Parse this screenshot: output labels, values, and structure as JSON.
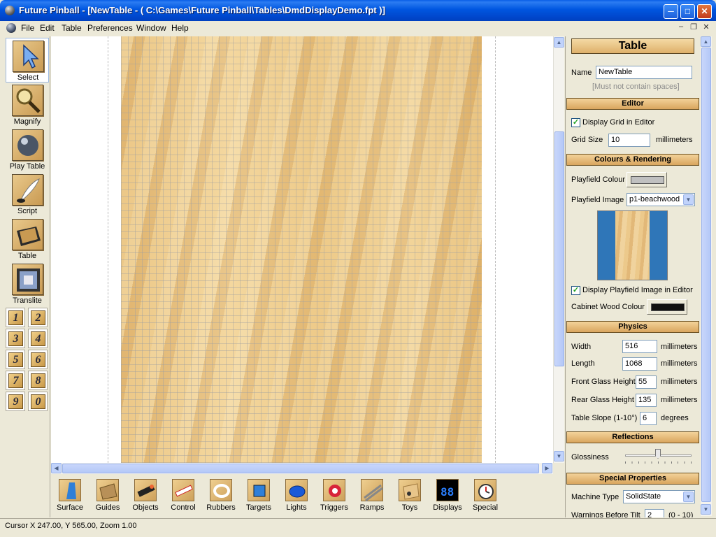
{
  "window": {
    "title": "Future Pinball - [NewTable - ( C:\\Games\\Future Pinball\\Tables\\DmdDisplayDemo.fpt )]",
    "minimize_glyph": "─",
    "maximize_glyph": "□",
    "close_glyph": "✕"
  },
  "menu": {
    "items": [
      "File",
      "Edit",
      "Table",
      "Preferences",
      "Window",
      "Help"
    ],
    "mdi_minimize": "–",
    "mdi_restore": "❐",
    "mdi_close": "✕"
  },
  "left_tools": [
    {
      "label": "Select",
      "icon": "cursor-arrow-icon",
      "selected": true
    },
    {
      "label": "Magnify",
      "icon": "magnifier-icon",
      "selected": false
    },
    {
      "label": "Play Table",
      "icon": "pinball-icon",
      "selected": false
    },
    {
      "label": "Script",
      "icon": "quill-pen-icon",
      "selected": false
    },
    {
      "label": "Table",
      "icon": "table-cabinet-icon",
      "selected": false
    },
    {
      "label": "Translite",
      "icon": "translite-icon",
      "selected": false
    }
  ],
  "number_buttons": [
    "1",
    "2",
    "3",
    "4",
    "5",
    "6",
    "7",
    "8",
    "9",
    "0"
  ],
  "bottom_tools": [
    {
      "label": "Surface",
      "icon": "surface-icon"
    },
    {
      "label": "Guides",
      "icon": "guides-icon"
    },
    {
      "label": "Objects",
      "icon": "objects-icon"
    },
    {
      "label": "Control",
      "icon": "control-icon"
    },
    {
      "label": "Rubbers",
      "icon": "rubbers-icon"
    },
    {
      "label": "Targets",
      "icon": "targets-icon"
    },
    {
      "label": "Lights",
      "icon": "lights-icon"
    },
    {
      "label": "Triggers",
      "icon": "triggers-icon"
    },
    {
      "label": "Ramps",
      "icon": "ramps-icon"
    },
    {
      "label": "Toys",
      "icon": "toys-icon"
    },
    {
      "label": "Displays",
      "icon": "displays-icon"
    },
    {
      "label": "Special",
      "icon": "special-icon"
    }
  ],
  "status": {
    "text": "Cursor X 247.00, Y 565.00, Zoom 1.00"
  },
  "props": {
    "title": "Table",
    "name_label": "Name",
    "name_value": "NewTable",
    "name_hint": "[Must not contain spaces]",
    "editor_section": "Editor",
    "display_grid_label": "Display Grid in Editor",
    "display_grid_checked": true,
    "grid_size_label": "Grid Size",
    "grid_size_value": "10",
    "grid_size_unit": "millimeters",
    "colours_section": "Colours & Rendering",
    "playfield_colour_label": "Playfield Colour",
    "playfield_colour": "#c0c0c0",
    "playfield_image_label": "Playfield Image",
    "playfield_image_value": "p1-beachwood",
    "display_playfield_label": "Display Playfield Image in Editor",
    "display_playfield_checked": true,
    "cabinet_colour_label": "Cabinet Wood Colour",
    "cabinet_colour": "#111111",
    "physics_section": "Physics",
    "width_label": "Width",
    "width_value": "516",
    "length_label": "Length",
    "length_value": "1068",
    "front_glass_label": "Front Glass Height",
    "front_glass_value": "55",
    "rear_glass_label": "Rear Glass Height",
    "rear_glass_value": "135",
    "slope_label": "Table Slope (1-10°)",
    "slope_value": "6",
    "slope_unit": "degrees",
    "mm_unit": "millimeters",
    "reflections_section": "Reflections",
    "glossiness_label": "Glossiness",
    "special_section": "Special Properties",
    "machine_type_label": "Machine Type",
    "machine_type_value": "SolidState",
    "warnings_label": "Warnings Before Tilt",
    "warnings_value": "2",
    "warnings_range": "(0 - 10)"
  },
  "colors": {
    "titlebar": "#0054e3",
    "playfield_wood": "#e9c482",
    "section_header": "#deb06a"
  }
}
